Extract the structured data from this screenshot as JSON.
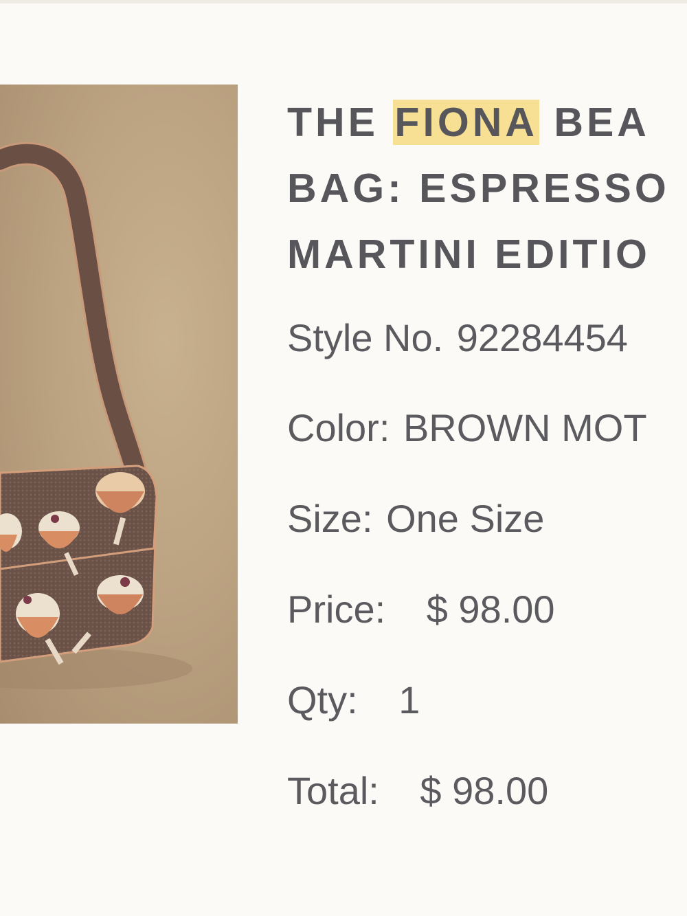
{
  "product": {
    "title_prefix": "THE ",
    "title_highlight": "FIONA",
    "title_line1_suffix": " BEA",
    "title_line2": "BAG: ESPRESSO",
    "title_line3": "MARTINI EDITIO"
  },
  "details": {
    "style_label": "Style No.",
    "style_value": "92284454",
    "color_label": "Color:",
    "color_value": "BROWN MOT",
    "size_label": "Size:",
    "size_value": "One Size",
    "price_label": "Price:",
    "price_value": "$ 98.00",
    "qty_label": "Qty:",
    "qty_value": "1",
    "total_label": "Total:",
    "total_value": "$ 98.00"
  },
  "colors": {
    "highlight": "#f7df93",
    "text": "#56565b",
    "background": "#fbfaf6",
    "bag": "#6e5547"
  },
  "image": {
    "icon": "beaded-bag-image"
  }
}
